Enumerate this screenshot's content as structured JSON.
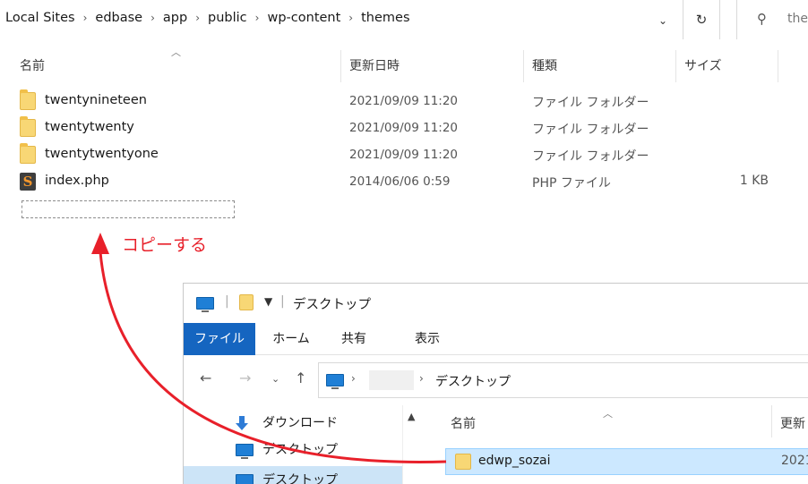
{
  "top_window": {
    "breadcrumbs": [
      "Local Sites",
      "edbase",
      "app",
      "public",
      "wp-content",
      "themes"
    ],
    "search_placeholder": "the",
    "columns": {
      "name": "名前",
      "modified": "更新日時",
      "type": "種類",
      "size": "サイズ"
    },
    "files": [
      {
        "name": "twentynineteen",
        "modified": "2021/09/09 11:20",
        "type": "ファイル フォルダー",
        "size": "",
        "icon": "folder-icon"
      },
      {
        "name": "twentytwenty",
        "modified": "2021/09/09 11:20",
        "type": "ファイル フォルダー",
        "size": "",
        "icon": "folder-icon"
      },
      {
        "name": "twentytwentyone",
        "modified": "2021/09/09 11:20",
        "type": "ファイル フォルダー",
        "size": "",
        "icon": "folder-icon"
      },
      {
        "name": "index.php",
        "modified": "2014/06/06 0:59",
        "type": "PHP ファイル",
        "size": "1 KB",
        "icon": "sublime-php-icon"
      }
    ]
  },
  "annotation": {
    "text": "コピーする",
    "color": "#e8202a"
  },
  "bottom_window": {
    "title": "デスクトップ",
    "ribbon_tabs": [
      {
        "label": "ファイル",
        "active": true
      },
      {
        "label": "ホーム",
        "active": false
      },
      {
        "label": "共有",
        "active": false
      },
      {
        "label": "表示",
        "active": false
      }
    ],
    "address_current": "デスクトップ",
    "nav_items": [
      {
        "label": "ダウンロード",
        "icon": "download-icon",
        "selected": false
      },
      {
        "label": "デスクトップ",
        "icon": "desktop-icon",
        "selected": false
      },
      {
        "label": "デスクトップ",
        "icon": "desktop-icon",
        "selected": true
      }
    ],
    "columns": {
      "name": "名前",
      "modified": "更新"
    },
    "files": [
      {
        "name": "edwp_sozai",
        "modified": "2021"
      }
    ]
  }
}
